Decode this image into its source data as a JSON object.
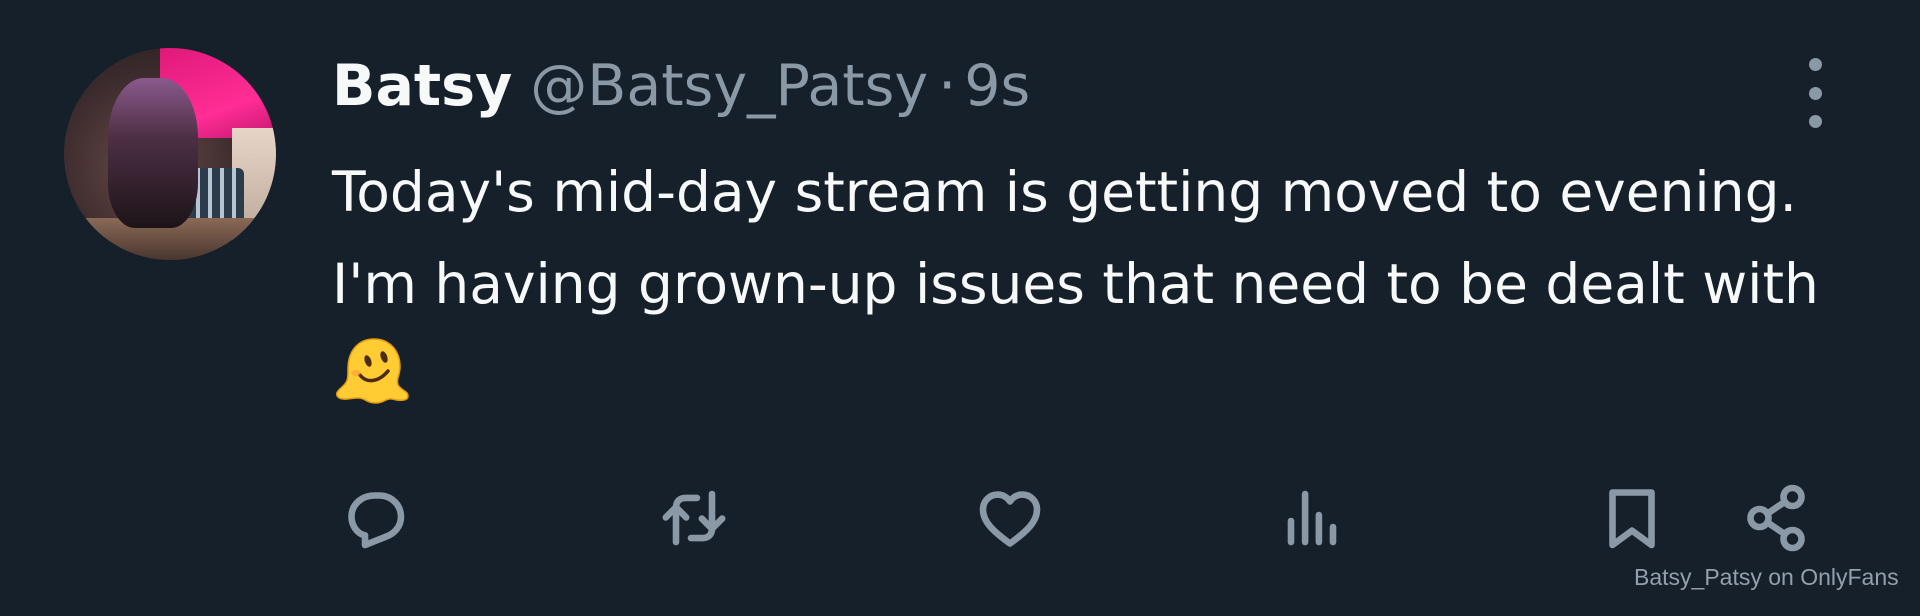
{
  "tweet": {
    "author_name": "Batsy",
    "author_handle": "@Batsy_Patsy",
    "separator": "·",
    "timestamp": "9s",
    "text": "Today's mid-day stream is getting moved to evening. I'm having grown-up issues that need to be dealt with",
    "emoji": "melting-face-emoji"
  },
  "actions": {
    "reply_icon": "reply-icon",
    "retweet_icon": "retweet-icon",
    "like_icon": "heart-icon",
    "views_icon": "analytics-icon",
    "bookmark_icon": "bookmark-icon",
    "share_icon": "share-icon",
    "more_icon": "more-vertical-icon"
  },
  "watermark": "Batsy_Patsy on OnlyFans",
  "colors": {
    "background": "#15202b",
    "text_primary": "#f7f9f9",
    "text_secondary": "#8b98a5"
  }
}
